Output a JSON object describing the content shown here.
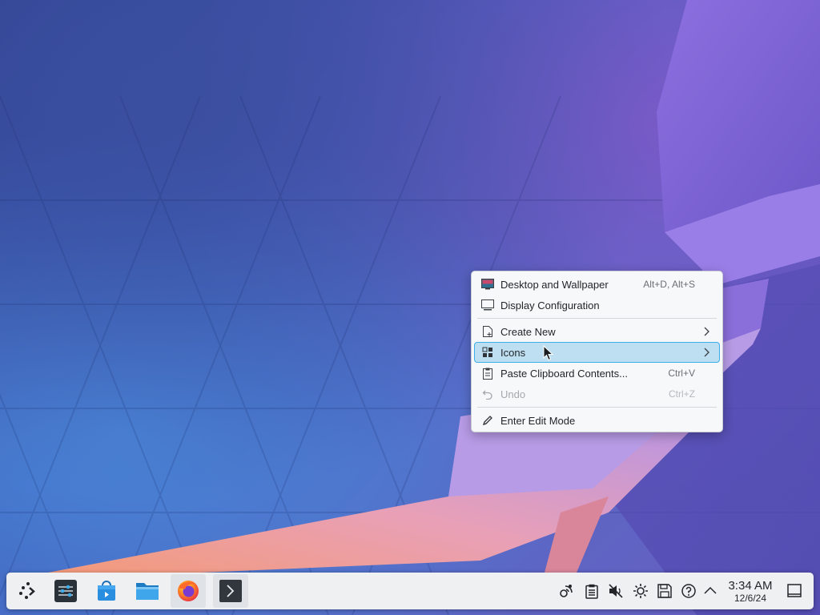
{
  "context_menu": {
    "items": [
      {
        "label": "Desktop and Wallpaper",
        "shortcut": "Alt+D, Alt+S",
        "icon": "desktop-wallpaper-icon"
      },
      {
        "label": "Display Configuration",
        "icon": "monitor-icon"
      },
      {
        "label": "Create New",
        "icon": "new-file-icon",
        "submenu": true
      },
      {
        "label": "Icons",
        "icon": "icons-grid-icon",
        "submenu": true,
        "highlighted": true
      },
      {
        "label": "Paste Clipboard Contents...",
        "shortcut": "Ctrl+V",
        "icon": "clipboard-icon"
      },
      {
        "label": "Undo",
        "shortcut": "Ctrl+Z",
        "icon": "undo-icon",
        "disabled": true
      },
      {
        "label": "Enter Edit Mode",
        "icon": "pencil-icon"
      }
    ]
  },
  "taskbar": {
    "launchers": [
      {
        "name": "application-launcher",
        "icon": "kde-launcher-icon"
      },
      {
        "name": "system-settings",
        "icon": "settings-sliders-icon"
      },
      {
        "name": "discover",
        "icon": "store-bag-icon"
      },
      {
        "name": "dolphin",
        "icon": "folder-icon"
      },
      {
        "name": "firefox",
        "icon": "firefox-icon"
      },
      {
        "name": "konsole",
        "icon": "terminal-icon"
      }
    ],
    "tray": [
      "network-icon",
      "clipboard-tray-icon",
      "volume-muted-icon",
      "brightness-icon",
      "disks-icon",
      "help-icon",
      "expand-tray-icon"
    ],
    "clock": {
      "time": "3:34 AM",
      "date": "12/6/24"
    },
    "show_desktop_icon": "show-desktop-icon"
  },
  "colors": {
    "highlight_bg": "#bedff2",
    "highlight_border": "#3daee9",
    "panel_bg": "#eef0f2"
  }
}
